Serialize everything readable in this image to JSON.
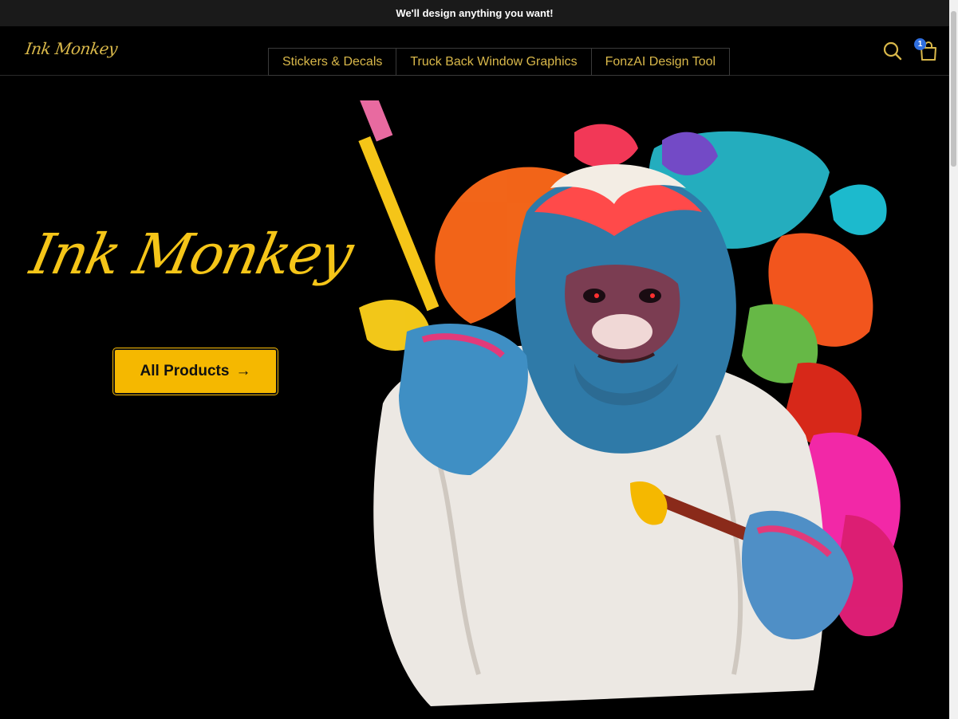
{
  "announcement": "We'll design anything you want!",
  "header": {
    "logo": "Ink Monkey",
    "nav": [
      {
        "label": "Stickers & Decals"
      },
      {
        "label": "Truck Back Window Graphics"
      },
      {
        "label": "FonzAI Design Tool"
      }
    ],
    "cart_count": "1"
  },
  "hero": {
    "title": "Ink Monkey",
    "cta_label": "All Products",
    "cta_arrow": "→",
    "illustration": "paint-splattered gorilla holding paintbrushes"
  },
  "colors": {
    "accent": "#f5c518",
    "button": "#f5b800",
    "nav_text": "#d9b84a",
    "badge": "#2f6fe0",
    "background": "#000000"
  }
}
